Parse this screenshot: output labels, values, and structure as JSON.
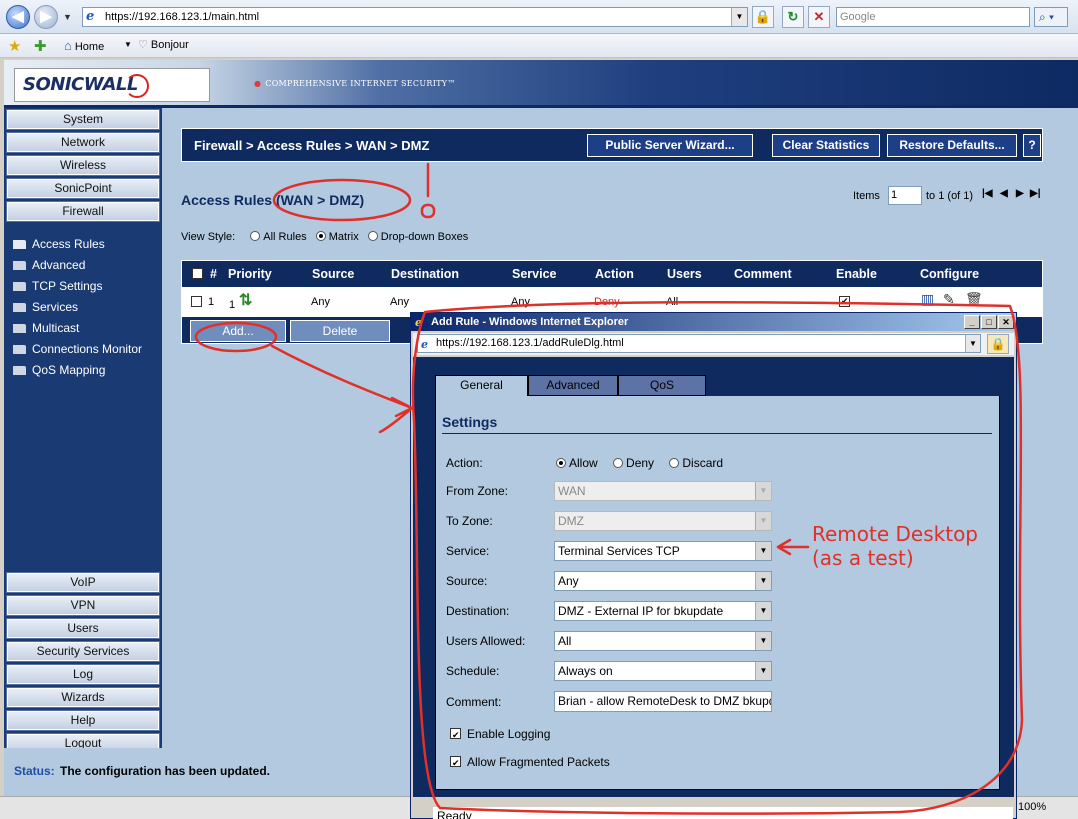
{
  "browser": {
    "url": "https://192.168.123.1/main.html",
    "search_placeholder": "Google",
    "favorites": {
      "home": "Home",
      "bonjour": "Bonjour"
    },
    "zoom": "100%"
  },
  "banner": {
    "logo": "SONICWALL",
    "tagline": "COMPREHENSIVE INTERNET SECURITY™"
  },
  "sidebar": {
    "top_items": [
      "System",
      "Network",
      "Wireless",
      "SonicPoint",
      "Firewall"
    ],
    "firewall_sub": [
      "Access Rules",
      "Advanced",
      "TCP Settings",
      "Services",
      "Multicast",
      "Connections Monitor",
      "QoS Mapping"
    ],
    "bottom_items": [
      "VoIP",
      "VPN",
      "Users",
      "Security Services",
      "Log",
      "Wizards",
      "Help",
      "Logout"
    ]
  },
  "header": {
    "breadcrumb": "Firewall > Access Rules > WAN > DMZ",
    "wizard_btn": "Public Server Wizard...",
    "clear_btn": "Clear Statistics",
    "restore_btn": "Restore Defaults...",
    "help_btn": "?"
  },
  "rules": {
    "title": "Access Rules (WAN > DMZ)",
    "items_label": "Items",
    "items_value": "1",
    "items_range": "to 1 (of 1)",
    "view_style_label": "View Style:",
    "view_options": [
      "All Rules",
      "Matrix",
      "Drop-down Boxes"
    ],
    "view_selected": "Matrix",
    "columns": [
      "#",
      "Priority",
      "Source",
      "Destination",
      "Service",
      "Action",
      "Users",
      "Comment",
      "Enable",
      "Configure"
    ],
    "row": {
      "num": "1",
      "priority": "1",
      "source": "Any",
      "destination": "Any",
      "service": "Any",
      "action": "Deny",
      "users": "All",
      "comment": "",
      "enabled": true
    },
    "add_btn": "Add...",
    "delete_btn": "Delete"
  },
  "status": {
    "label": "Status:",
    "message": "The configuration has been updated."
  },
  "popup": {
    "title": "Add Rule - Windows Internet Explorer",
    "url": "https://192.168.123.1/addRuleDlg.html",
    "tabs": [
      "General",
      "Advanced",
      "QoS"
    ],
    "settings_title": "Settings",
    "action_label": "Action:",
    "action_options": [
      "Allow",
      "Deny",
      "Discard"
    ],
    "action_selected": "Allow",
    "fields": [
      {
        "label": "From Zone:",
        "value": "WAN",
        "disabled": true
      },
      {
        "label": "To Zone:",
        "value": "DMZ",
        "disabled": true
      },
      {
        "label": "Service:",
        "value": "Terminal Services TCP",
        "disabled": false
      },
      {
        "label": "Source:",
        "value": "Any",
        "disabled": false
      },
      {
        "label": "Destination:",
        "value": "DMZ - External IP for bkupdate",
        "disabled": false
      },
      {
        "label": "Users Allowed:",
        "value": "All",
        "disabled": false
      },
      {
        "label": "Schedule:",
        "value": "Always on",
        "disabled": false
      }
    ],
    "comment_label": "Comment:",
    "comment_value": "Brian - allow RemoteDesk to DMZ bkupdate",
    "enable_logging": "Enable Logging",
    "allow_fragmented": "Allow Fragmented Packets",
    "status_text": "Ready"
  },
  "annotation": {
    "line1": "Remote Desktop",
    "line2": "(as a test)",
    "color": "#e0302a"
  }
}
